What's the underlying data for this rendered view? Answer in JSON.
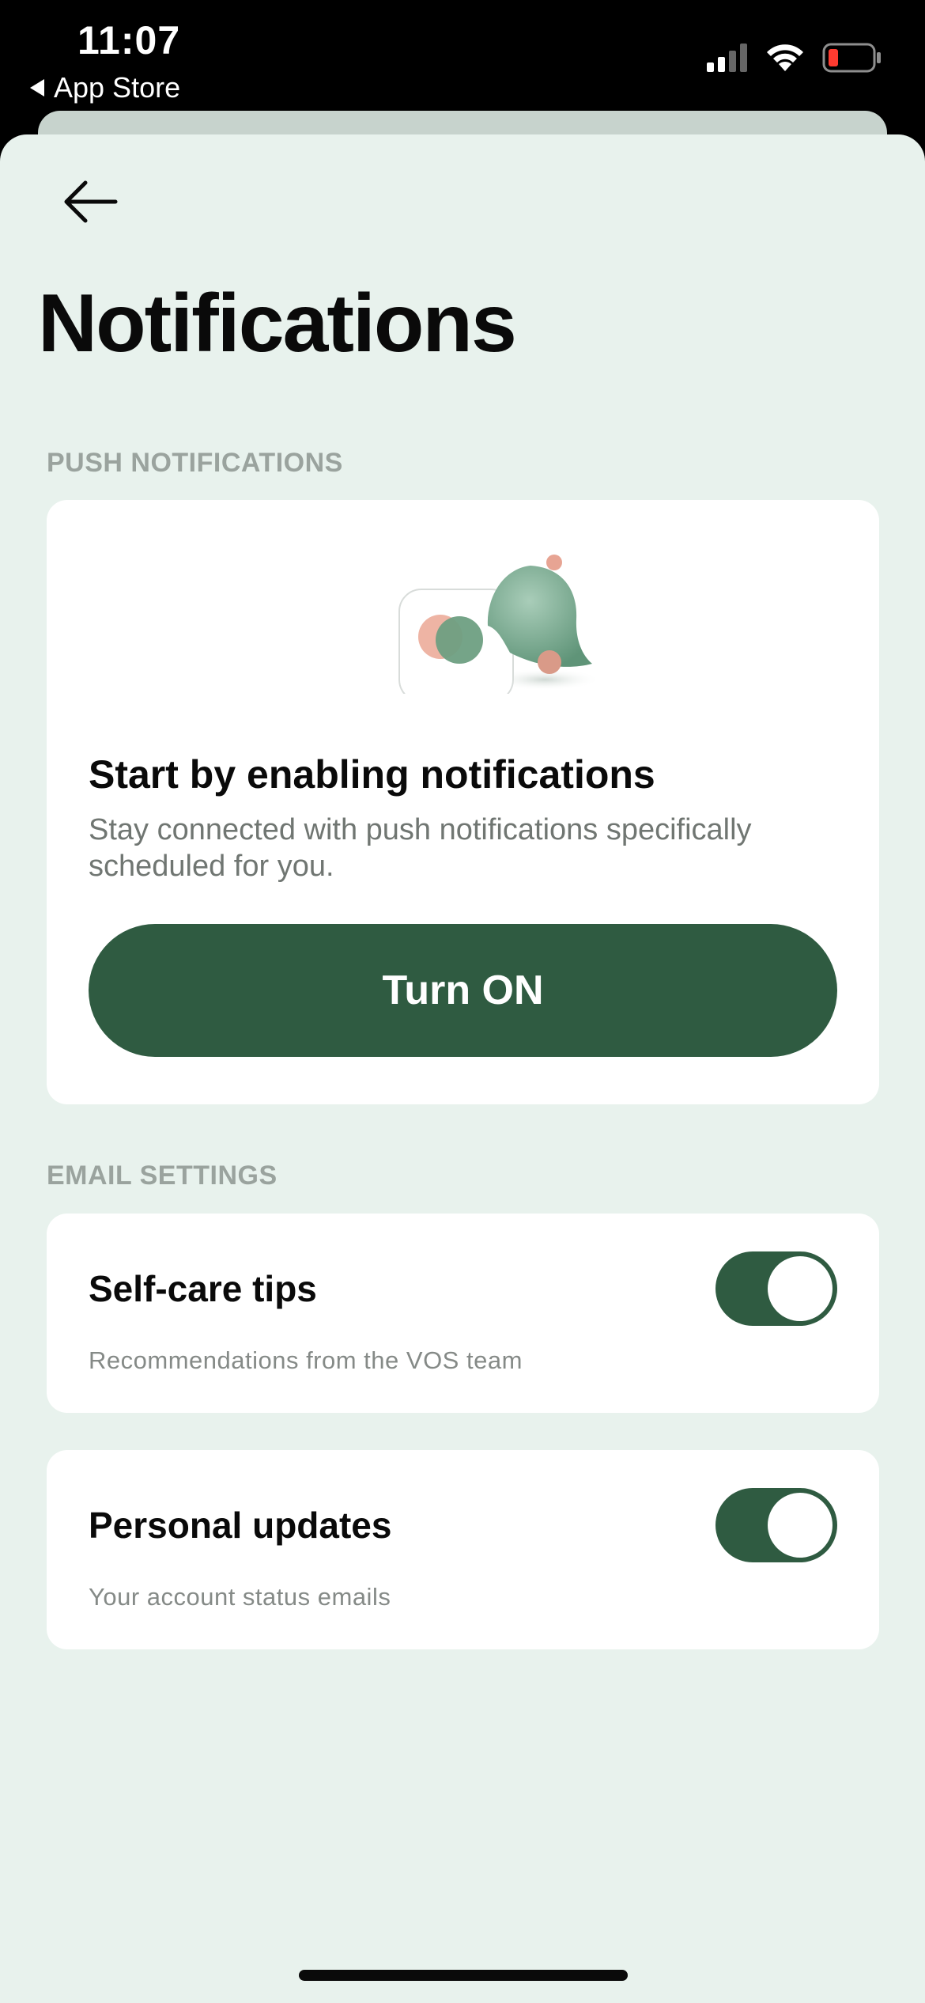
{
  "status_bar": {
    "time": "11:07",
    "back_app": "App Store",
    "icons": [
      "signal-icon",
      "wifi-icon",
      "battery-icon"
    ],
    "battery_color": "#ff3b30"
  },
  "header": {
    "back_icon": "arrow-left-icon",
    "title": "Notifications"
  },
  "push": {
    "section_label": "PUSH NOTIFICATIONS",
    "title": "Start by enabling notifications",
    "description": "Stay connected with push notifications specifically scheduled for you.",
    "button_label": "Turn ON",
    "illustration": "bell-and-app-icon"
  },
  "email": {
    "section_label": "EMAIL SETTINGS",
    "items": [
      {
        "title": "Self-care tips",
        "description": "Recommendations from the VOS team",
        "enabled": true
      },
      {
        "title": "Personal updates",
        "description": "Your account status emails",
        "enabled": true
      }
    ]
  },
  "colors": {
    "accent": "#2f5b41",
    "background": "#e8f2ed",
    "card": "#ffffff"
  }
}
